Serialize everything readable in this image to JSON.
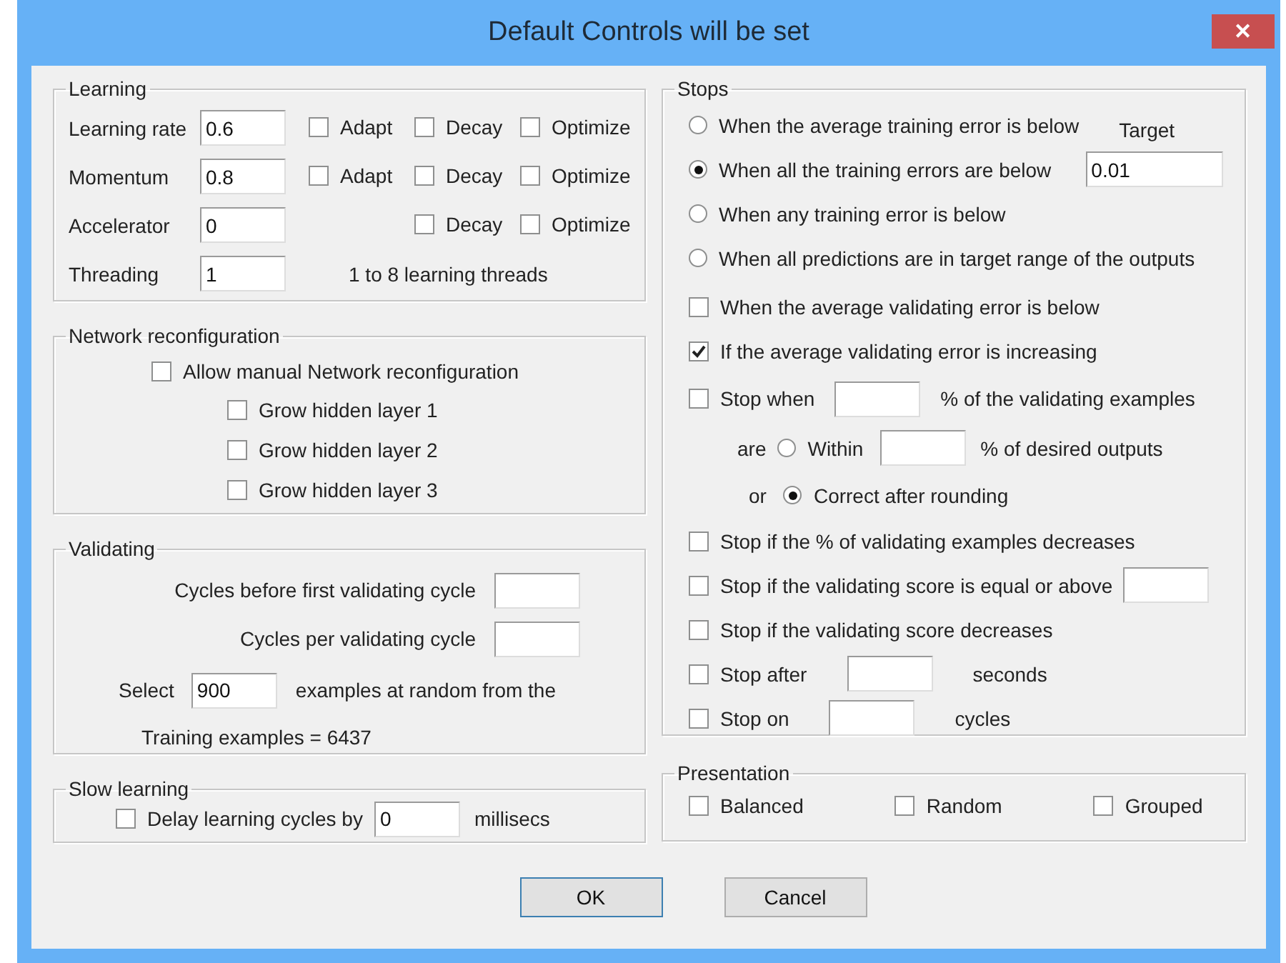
{
  "window": {
    "title": "Default Controls will be set",
    "close": "✕"
  },
  "learning": {
    "title": "Learning",
    "rows": [
      {
        "label": "Learning rate",
        "value": "0.6",
        "options": [
          {
            "kind": "adapt",
            "label": "Adapt",
            "checked": false
          },
          {
            "kind": "decay",
            "label": "Decay",
            "checked": false
          },
          {
            "kind": "optimize",
            "label": "Optimize",
            "checked": false
          }
        ]
      },
      {
        "label": "Momentum",
        "value": "0.8",
        "options": [
          {
            "kind": "adapt",
            "label": "Adapt",
            "checked": false
          },
          {
            "kind": "decay",
            "label": "Decay",
            "checked": false
          },
          {
            "kind": "optimize",
            "label": "Optimize",
            "checked": false
          }
        ]
      },
      {
        "label": "Accelerator",
        "value": "0",
        "options": [
          {
            "kind": "decay",
            "label": "Decay",
            "checked": false
          },
          {
            "kind": "optimize",
            "label": "Optimize",
            "checked": false
          }
        ]
      },
      {
        "label": "Threading",
        "value": "1",
        "note": "1 to 8 learning threads"
      }
    ]
  },
  "network": {
    "title": "Network reconfiguration",
    "main": {
      "label": "Allow manual Network reconfiguration",
      "checked": false
    },
    "items": [
      {
        "label": "Grow hidden layer 1",
        "checked": false
      },
      {
        "label": "Grow hidden layer 2",
        "checked": false
      },
      {
        "label": "Grow hidden layer 3",
        "checked": false
      }
    ]
  },
  "validating": {
    "title": "Validating",
    "first_label": "Cycles before first validating cycle",
    "per_label": "Cycles per validating cycle",
    "select_label": "Select",
    "select_value": "900",
    "select_suffix": "examples at random from the",
    "training": "Training examples = 6437"
  },
  "slow": {
    "title": "Slow learning",
    "label": "Delay learning cycles by",
    "checked": false,
    "value": "0",
    "suffix": "millisecs"
  },
  "stops": {
    "title": "Stops",
    "items": [
      {
        "kind": "radio",
        "label": "When the average training error is below",
        "selected": false,
        "aside": "Target"
      },
      {
        "kind": "radio-input",
        "label": "When all the training errors are below",
        "selected": true,
        "value": "0.01"
      },
      {
        "kind": "radio",
        "label": "When any training error is below",
        "selected": false
      },
      {
        "kind": "radio",
        "label": "When all predictions are in target range of the outputs",
        "selected": false
      },
      {
        "kind": "checkbox",
        "label": "When the average validating error is below",
        "checked": false
      },
      {
        "kind": "checkbox",
        "label": "If the average validating error is increasing",
        "checked": true
      },
      {
        "kind": "checkbox-input",
        "label": "Stop when",
        "checked": false,
        "suffix": "% of the validating examples"
      },
      {
        "kind": "sub-radio-input",
        "prefix": "are",
        "label": "Within",
        "selected": false,
        "suffix": "% of desired outputs"
      },
      {
        "kind": "sub-radio",
        "prefix": "or",
        "label": "Correct after rounding",
        "selected": true
      },
      {
        "kind": "checkbox",
        "label": "Stop if the % of validating examples decreases",
        "checked": false
      },
      {
        "kind": "checkbox-tail",
        "label": "Stop if the validating score is equal or above",
        "checked": false
      },
      {
        "kind": "checkbox",
        "label": "Stop if the validating score decreases",
        "checked": false
      },
      {
        "kind": "checkbox-input",
        "label": "Stop after",
        "checked": false,
        "suffix": "seconds"
      },
      {
        "kind": "checkbox-input",
        "label": "Stop on",
        "checked": false,
        "suffix": "cycles"
      }
    ]
  },
  "presentation": {
    "title": "Presentation",
    "items": [
      {
        "label": "Balanced",
        "checked": false
      },
      {
        "label": "Random",
        "checked": false
      },
      {
        "label": "Grouped",
        "checked": false
      }
    ]
  },
  "buttons": [
    "OK",
    "Cancel"
  ]
}
